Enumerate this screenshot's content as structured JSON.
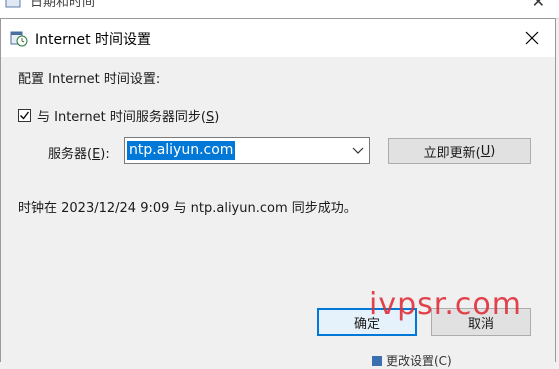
{
  "parent_window": {
    "title": "日期和时间"
  },
  "dialog": {
    "title": "Internet 时间设置",
    "section_label": "配置 Internet 时间设置:",
    "sync_checkbox": {
      "label_prefix": "与 Internet 时间服务器同步(",
      "accel": "S",
      "label_suffix": ")",
      "checked": true
    },
    "server_label": {
      "prefix": "服务器(",
      "accel": "E",
      "suffix": "):"
    },
    "server_value": "ntp.aliyun.com",
    "update_button": {
      "prefix": "立即更新(",
      "accel": "U",
      "suffix": ")"
    },
    "status": "时钟在 2023/12/24 9:09 与 ntp.aliyun.com 同步成功。",
    "ok_label": "确定",
    "cancel_label": "取消"
  },
  "watermark": "ivpsr.com",
  "bottom_peek": "更改设置(C)",
  "colors": {
    "accent": "#0078d7",
    "watermark": "#e0303a"
  }
}
